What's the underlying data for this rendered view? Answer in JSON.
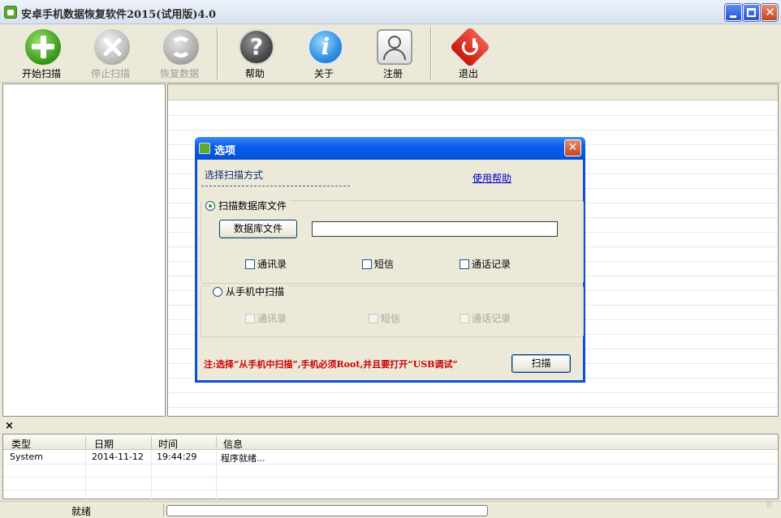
{
  "window": {
    "title": "安卓手机数据恢复软件2015(试用版)4.0"
  },
  "toolbar": {
    "start_scan": "开始扫描",
    "stop_scan": "停止扫描",
    "recover": "恢复数据",
    "help": "帮助",
    "about": "关于",
    "register": "注册",
    "exit": "退出"
  },
  "log": {
    "close_glyph": "×",
    "columns": [
      "类型",
      "日期",
      "时间",
      "信息"
    ],
    "rows": [
      {
        "type": "System",
        "date": "2014-11-12",
        "time": "19:44:29",
        "info": "程序就绪..."
      }
    ]
  },
  "statusbar": {
    "status": "就绪"
  },
  "dialog": {
    "title": "选项",
    "scan_mode_label": "选择扫描方式",
    "help_link": "使用帮助",
    "option_db": {
      "label": "扫描数据库文件",
      "selected": true
    },
    "db_button": "数据库文件",
    "db_path": "",
    "db_checkboxes": {
      "contacts": "通讯录",
      "sms": "短信",
      "calls": "通话记录"
    },
    "option_phone": {
      "label": "从手机中扫描",
      "selected": false
    },
    "phone_checkboxes": {
      "contacts": "通讯录",
      "sms": "短信",
      "calls": "通话记录"
    },
    "note": "注:选择“从手机中扫描”,手机必须Root,并且要打开“USB调试”",
    "scan_button": "扫描"
  }
}
